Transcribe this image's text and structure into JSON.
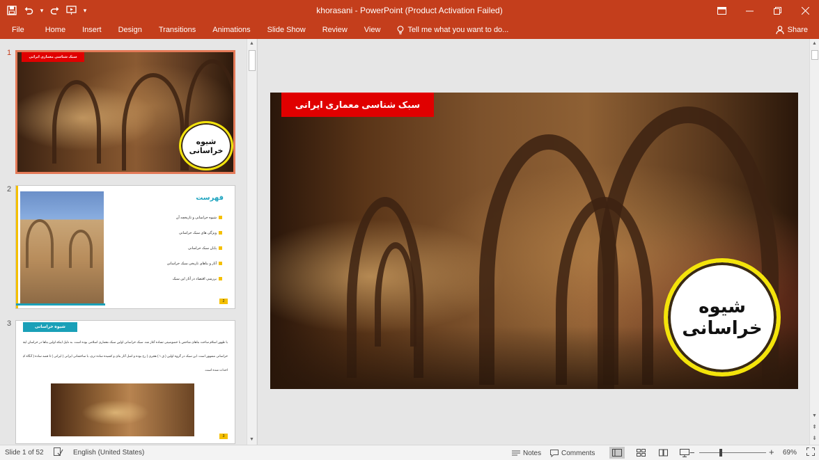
{
  "titlebar": {
    "title": "khorasani - PowerPoint (Product Activation Failed)",
    "qat": {
      "save_icon": "save-icon",
      "undo_icon": "undo-icon",
      "redo_icon": "redo-icon",
      "present_icon": "slideshow-from-beginning-icon",
      "customize_icon": "customize-qat-icon"
    },
    "controls": {
      "ribbon_display_icon": "ribbon-display-options-icon",
      "minimize_icon": "minimize-icon",
      "restore_icon": "restore-icon",
      "close_icon": "close-icon"
    }
  },
  "ribbon": {
    "file": "File",
    "tabs": [
      "Home",
      "Insert",
      "Design",
      "Transitions",
      "Animations",
      "Slide Show",
      "Review",
      "View"
    ],
    "tell_me": "Tell me what you want to do...",
    "share": "Share"
  },
  "thumbnails": [
    {
      "number": "1",
      "banner": "سبک شناسی معماری ایرانی",
      "badge": "شیوه خراسانی"
    },
    {
      "number": "2",
      "title": "فهرست",
      "items": [
        "شیوه خراسانی و تاریخچه آن",
        "ویژگی های سبک خراسانی",
        "پایان سبک خراسانی",
        "آثار و بناهای تاریخی سبک خراسانی",
        "بررسی اقتصاد در آثار این سبک"
      ],
      "page": "2"
    },
    {
      "number": "3",
      "tag": "شیوه خراسانی",
      "lines": [
        "با ظهور اسلام ساخت بناهای شاخص با خصوصیتی تساده آغاز شد. سبک خراسانی اولین سبک معماری اسلامی بوده است. به دلیل اینکه اولین بناها در خراسان ایجاد شده است به سبک",
        "خراسانی مشهور است. این سبک در گروه اولین ( ق ۱ ) هجری ) رخ بوده و اصل آثار بنای و کشیده ساده تری، با ساختمانی ایرانی ( ایرانی ) تا قصد ساده ( آنگاه کرانه ) تا",
        "احداث شده است."
      ],
      "page": "3"
    }
  ],
  "main_slide": {
    "banner": "سبک شناسی معماری ایرانی",
    "badge": "شیوه خراسانی"
  },
  "statusbar": {
    "slide_info": "Slide 1 of 52",
    "language": "English (United States)",
    "notes": "Notes",
    "comments": "Comments",
    "zoom": "69%",
    "zoom_fraction": 0.69
  },
  "colors": {
    "accent": "#c43e1c",
    "banner_red": "#e00000",
    "badge_ring": "#f4e40a",
    "toc_title": "#21a5c0",
    "toc_bullet": "#f5c000"
  }
}
